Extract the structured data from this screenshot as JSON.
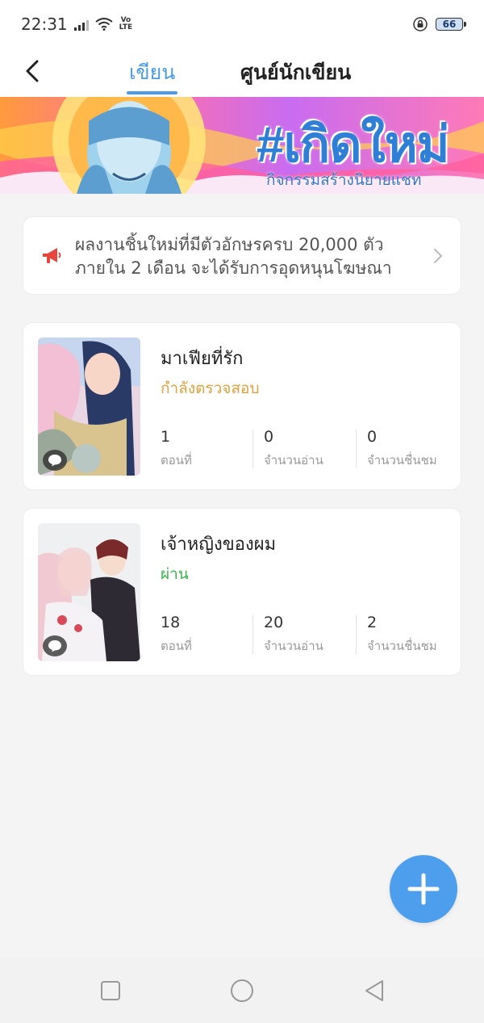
{
  "status_bar": {
    "time": "22:31",
    "volte_top": "Vo",
    "volte_bottom": "LTE",
    "battery": "66"
  },
  "header": {
    "tabs": [
      {
        "label": "เขียน",
        "active": true
      },
      {
        "label": "ศูนย์นักเขียน",
        "active": false
      }
    ]
  },
  "banner": {
    "title": "#เกิดใหม่",
    "subtitle": "กิจกรรมสร้างนิยายแชท"
  },
  "notice": {
    "text": "ผลงานชิ้นใหม่ที่มีตัวอักษรครบ 20,000 ตัว ภายใน 2 เดือน จะได้รับการอุดหนุนโฆษณา",
    "icon": "megaphone-icon"
  },
  "stories": [
    {
      "title": "มาเฟียที่รัก",
      "status": "กำลังตรวจสอบ",
      "status_color": "#e0a03c",
      "stats": [
        {
          "value": "1",
          "label": "ตอนที่"
        },
        {
          "value": "0",
          "label": "จำนวนอ่าน"
        },
        {
          "value": "0",
          "label": "จำนวนชื่นชม"
        }
      ]
    },
    {
      "title": "เจ้าหญิงของผม",
      "status": "ผ่าน",
      "status_color": "#38b44a",
      "stats": [
        {
          "value": "18",
          "label": "ตอนที่"
        },
        {
          "value": "20",
          "label": "จำนวนอ่าน"
        },
        {
          "value": "2",
          "label": "จำนวนชื่นชม"
        }
      ]
    }
  ],
  "colors": {
    "accent": "#4a9be8",
    "fab": "#4e9eee",
    "background": "#f4f4f4"
  }
}
